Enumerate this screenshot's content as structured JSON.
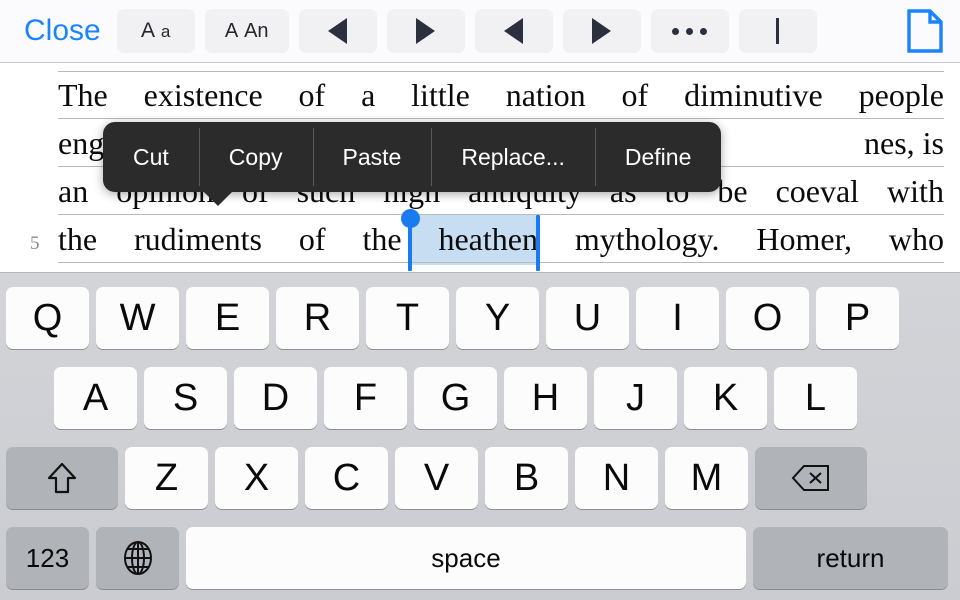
{
  "toolbar": {
    "close_label": "Close",
    "font_smaller_label": "A a",
    "font_larger_label": "A An",
    "prev_page_icon": "triangle-left-icon",
    "next_page_icon": "triangle-right-icon",
    "prev_item_icon": "triangle-left-icon",
    "next_item_icon": "triangle-right-icon",
    "more_label": "•••",
    "more_icon": "ellipsis-icon",
    "caret_icon": "text-cursor-icon",
    "document_icon": "document-page-icon",
    "accent_color": "#1a84ff",
    "button_bg": "#f1f1f4",
    "bar_bg": "#fbfbfd"
  },
  "document": {
    "lines": [
      {
        "number": "",
        "words": [
          "The",
          "existence",
          "of",
          "a",
          "little",
          "nation",
          "of",
          "diminutive",
          "people"
        ]
      },
      {
        "number": "",
        "words": [
          "eng",
          "nes, is"
        ]
      },
      {
        "number": "",
        "words": [
          "an",
          "opinion",
          "of",
          "such",
          "high",
          "antiquity",
          "as",
          "to",
          "be",
          "coeval",
          "with"
        ]
      },
      {
        "number": "5",
        "words": [
          "the",
          "rudiments",
          "of",
          "the",
          "heathen",
          "mythology.",
          "Homer,",
          "who"
        ]
      }
    ],
    "selected_text": "heathen",
    "selection_color": "#bed8f0",
    "handle_color": "#1a7af0"
  },
  "edit_menu": {
    "items": [
      {
        "label": "Cut"
      },
      {
        "label": "Copy"
      },
      {
        "label": "Paste"
      },
      {
        "label": "Replace..."
      },
      {
        "label": "Define"
      }
    ],
    "background": "#2b2b2b"
  },
  "keyboard": {
    "row1": [
      "Q",
      "W",
      "E",
      "R",
      "T",
      "Y",
      "U",
      "I",
      "O",
      "P"
    ],
    "row2": [
      "A",
      "S",
      "D",
      "F",
      "G",
      "H",
      "J",
      "K",
      "L"
    ],
    "row3": [
      "Z",
      "X",
      "C",
      "V",
      "B",
      "N",
      "M"
    ],
    "shift_icon": "shift-arrow-icon",
    "delete_icon": "backspace-delete-icon",
    "numeric_label": "123",
    "globe_icon": "globe-language-icon",
    "space_label": "space",
    "return_label": "return",
    "key_bg": "#fcfcfd",
    "modifier_bg": "#b0b3b8",
    "board_bg": "#d0d2d6"
  }
}
